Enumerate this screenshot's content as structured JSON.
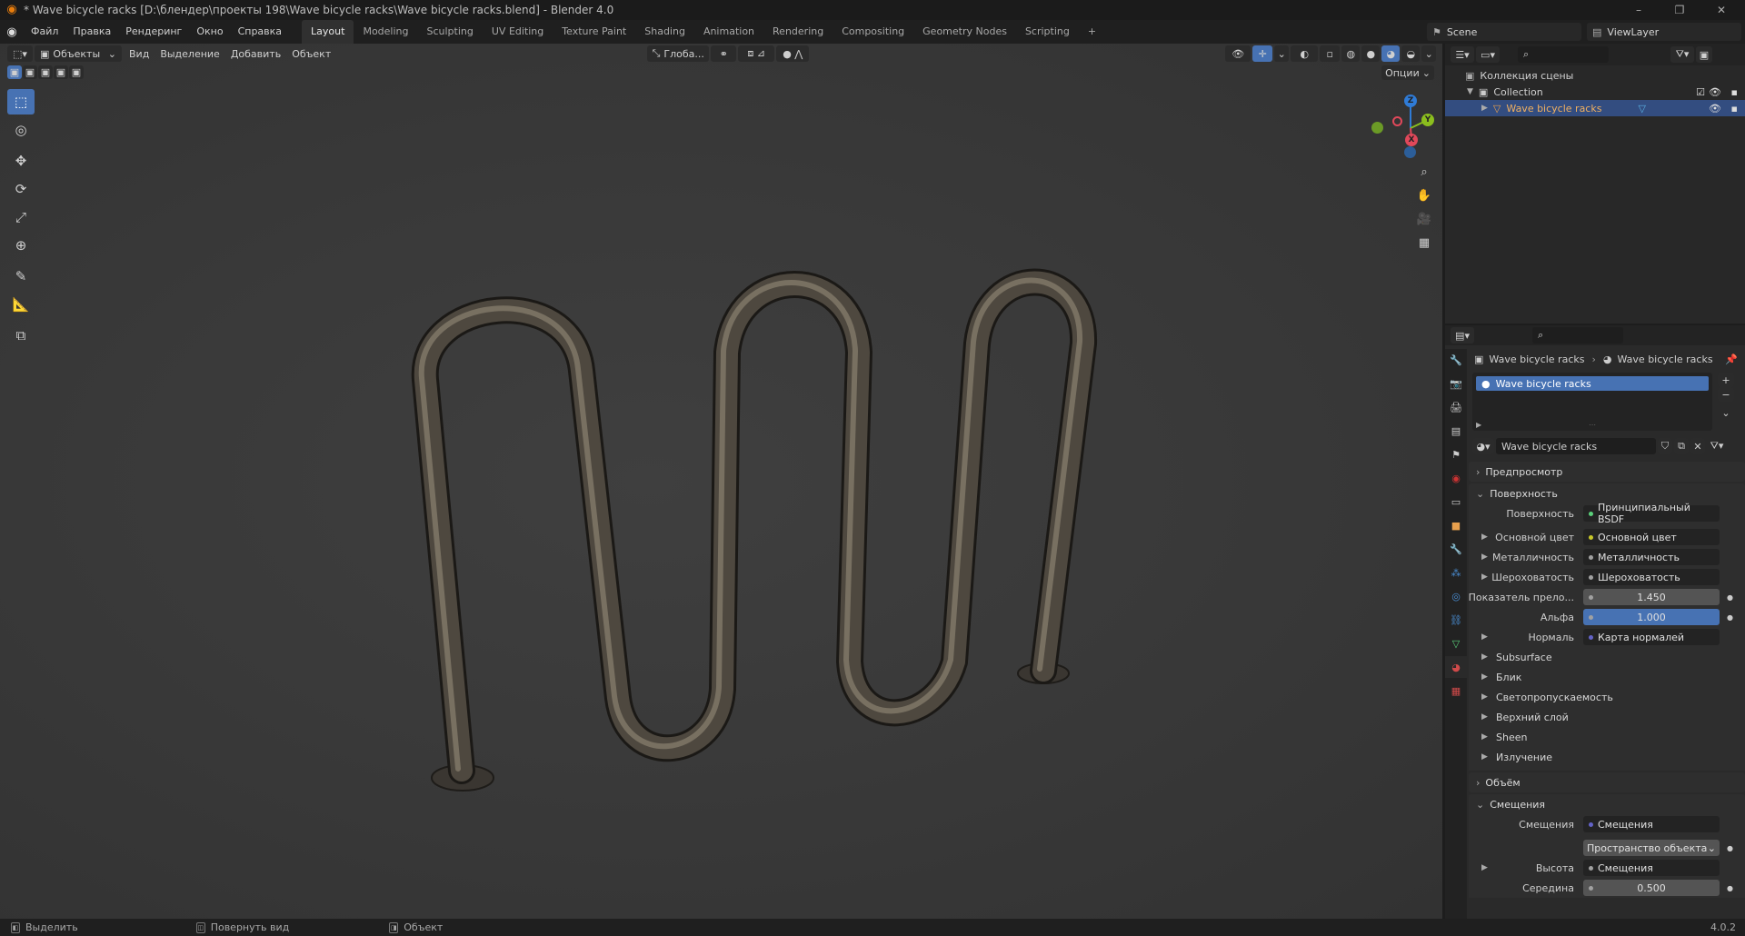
{
  "window": {
    "title": "* Wave bicycle racks [D:\\блендер\\проекты 198\\Wave bicycle racks\\Wave bicycle racks.blend] - Blender 4.0",
    "minimize": "–",
    "maximize": "❐",
    "close": "✕"
  },
  "menu": {
    "items": [
      "Файл",
      "Правка",
      "Рендеринг",
      "Окно",
      "Справка"
    ]
  },
  "workspaces": {
    "tabs": [
      "Layout",
      "Modeling",
      "Sculpting",
      "UV Editing",
      "Texture Paint",
      "Shading",
      "Animation",
      "Rendering",
      "Compositing",
      "Geometry Nodes",
      "Scripting"
    ],
    "active": "Layout",
    "add": "+"
  },
  "scene": {
    "name": "Scene",
    "view_layer": "ViewLayer"
  },
  "viewport": {
    "mode": "Объекты",
    "menus": [
      "Вид",
      "Выделение",
      "Добавить",
      "Объект"
    ],
    "transform_orientation": "Глоба...",
    "options": "Опции"
  },
  "gizmo": {
    "x": "X",
    "y": "Y",
    "z": "Z"
  },
  "outliner": {
    "root": "Коллекция сцены",
    "collection": "Collection",
    "object": "Wave bicycle racks"
  },
  "properties": {
    "breadcrumb_object": "Wave bicycle racks",
    "breadcrumb_material": "Wave bicycle racks",
    "material_slot": "Wave bicycle racks",
    "material_name": "Wave bicycle racks",
    "panels": {
      "preview": "Предпросмотр",
      "surface": "Поверхность",
      "volume": "Объём",
      "displacement": "Смещения"
    },
    "surface": {
      "surface_label": "Поверхность",
      "surface_value": "Принципиальный BSDF",
      "base_color_label": "Основной цвет",
      "base_color_value": "Основной цвет",
      "metallic_label": "Металличность",
      "metallic_value": "Металличность",
      "roughness_label": "Шероховатость",
      "roughness_value": "Шероховатость",
      "ior_label": "Показатель прело...",
      "ior_value": "1.450",
      "alpha_label": "Альфа",
      "alpha_value": "1.000",
      "normal_label": "Нормаль",
      "normal_value": "Карта нормалей",
      "sub_items": [
        "Subsurface",
        "Блик",
        "Светопропускаемость",
        "Верхний слой",
        "Sheen",
        "Излучение"
      ]
    },
    "displacement": {
      "disp_label": "Смещения",
      "disp_value": "Смещения",
      "space_value": "Пространство объекта",
      "height_label": "Высота",
      "height_value": "Смещения",
      "midlevel_label": "Середина",
      "midlevel_value": "0.500"
    }
  },
  "status": {
    "select": "Выделить",
    "rotate": "Повернуть вид",
    "object": "Объект",
    "version": "4.0.2"
  }
}
